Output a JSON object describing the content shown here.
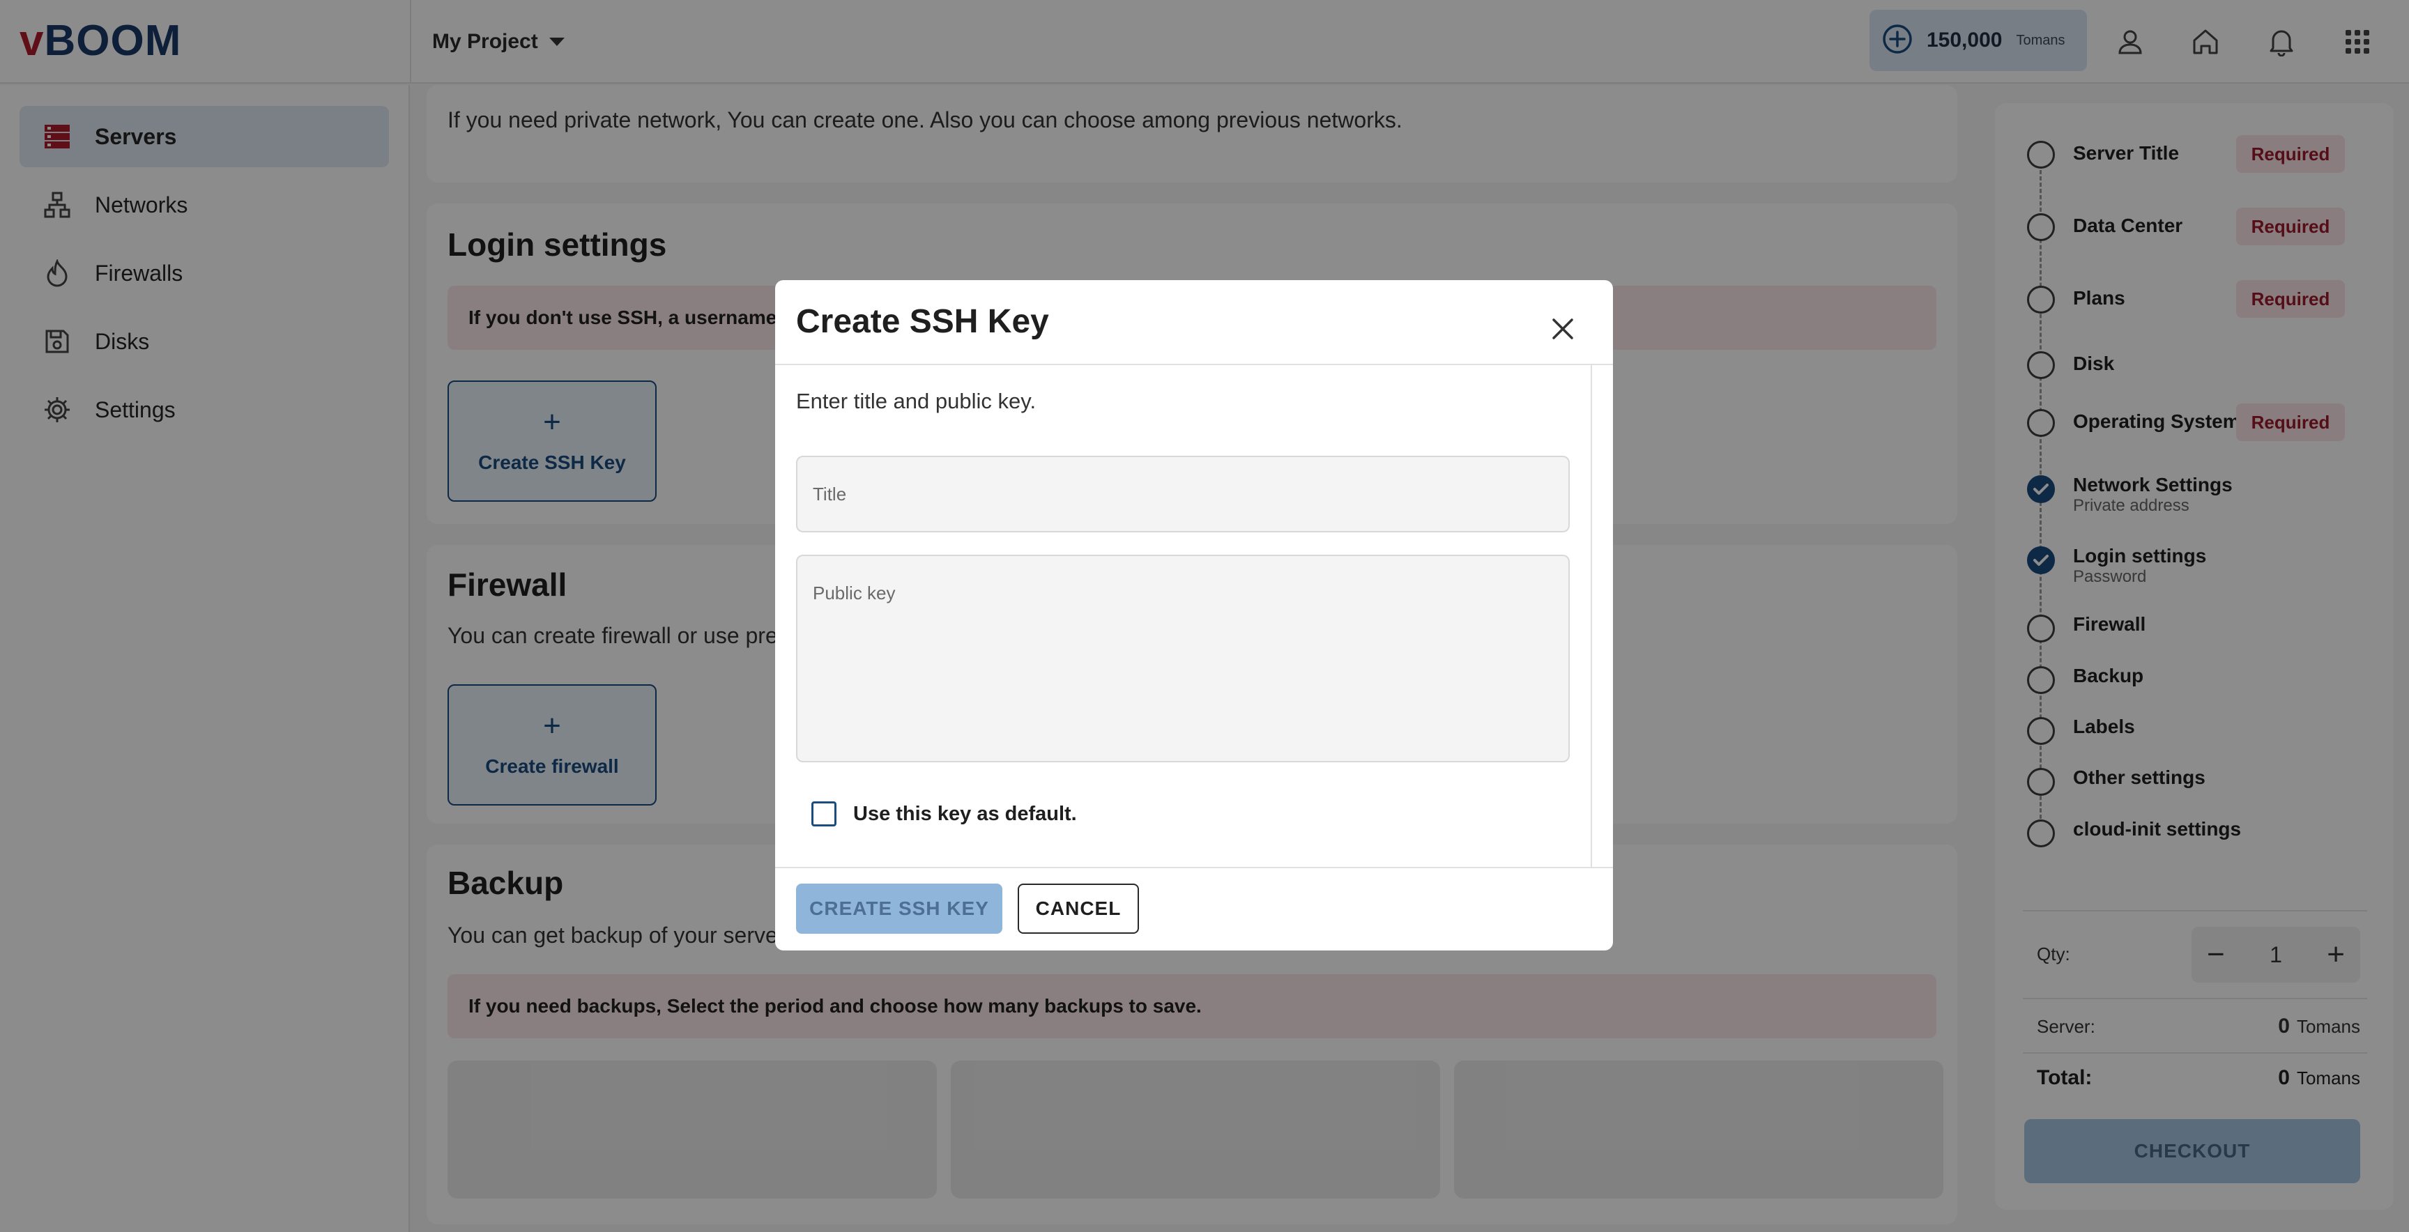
{
  "header": {
    "logo_prefix": "v",
    "logo_rest": "BOOM",
    "project": "My Project",
    "balance_amount": "150,000",
    "balance_unit": "Tomans"
  },
  "sidebar": {
    "items": [
      {
        "label": "Servers",
        "icon": "servers-icon"
      },
      {
        "label": "Networks",
        "icon": "network-icon"
      },
      {
        "label": "Firewalls",
        "icon": "fire-icon"
      },
      {
        "label": "Disks",
        "icon": "disk-icon"
      },
      {
        "label": "Settings",
        "icon": "gear-icon"
      }
    ]
  },
  "main": {
    "network_text": "If you need private network, You can create one. Also you can choose among previous networks.",
    "login_title": "Login settings",
    "login_alert": "If you don't use SSH, a username &",
    "create_ssh_label": "Create SSH Key",
    "firewall_title": "Firewall",
    "firewall_text": "You can create firewall or use prev",
    "create_firewall_label": "Create firewall",
    "backup_title": "Backup",
    "backup_text": "You can get backup of your server",
    "backup_alert": "If you need backups, Select the period and choose how many backups to save."
  },
  "steps": [
    {
      "label": "Server Title",
      "required": "Required",
      "done": false
    },
    {
      "label": "Data Center",
      "required": "Required",
      "done": false
    },
    {
      "label": "Plans",
      "required": "Required",
      "done": false
    },
    {
      "label": "Disk",
      "done": false
    },
    {
      "label": "Operating System",
      "required": "Required",
      "done": false
    },
    {
      "label": "Network Settings",
      "sub": "Private address",
      "done": true
    },
    {
      "label": "Login settings",
      "sub": "Password",
      "done": true
    },
    {
      "label": "Firewall",
      "done": false
    },
    {
      "label": "Backup",
      "done": false
    },
    {
      "label": "Labels",
      "done": false
    },
    {
      "label": "Other settings",
      "done": false
    },
    {
      "label": "cloud-init settings",
      "done": false
    }
  ],
  "summary": {
    "qty_label": "Qty:",
    "qty_value": "1",
    "server_label": "Server:",
    "server_value": "0",
    "total_label": "Total:",
    "total_value": "0",
    "unit": "Tomans",
    "checkout_label": "CHECKOUT"
  },
  "modal": {
    "title": "Create SSH Key",
    "description": "Enter title and public key.",
    "title_placeholder": "Title",
    "key_placeholder": "Public key",
    "default_label": "Use this key as default.",
    "create_label": "CREATE SSH KEY",
    "cancel_label": "CANCEL"
  },
  "colors": {
    "brand_dark": "#1b3a6b",
    "brand_red": "#b01a2a",
    "accent_blue": "#1b4c80",
    "required_bg": "#fbe4e7",
    "required_text": "#9b1b2a"
  }
}
